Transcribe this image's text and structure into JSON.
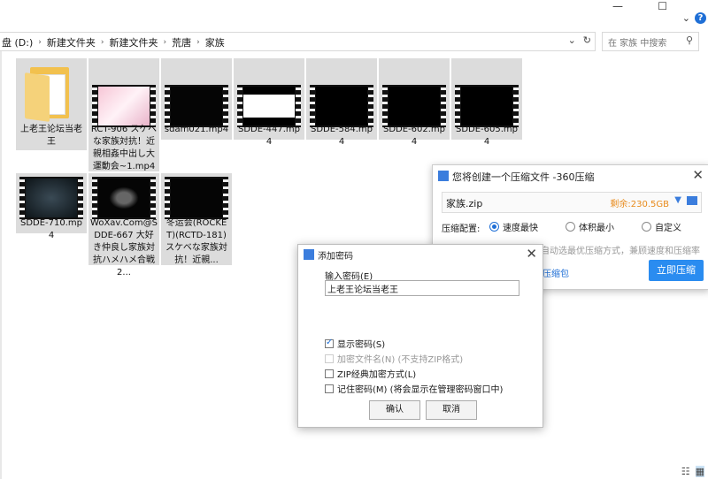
{
  "explorer": {
    "breadcrumbs": [
      "盘 (D:)",
      "新建文件夹",
      "新建文件夹",
      "荒唐",
      "家族"
    ],
    "search_placeholder": "在 家族 中搜索",
    "files": [
      {
        "name": "上老王论坛当老王",
        "type": "folder"
      },
      {
        "name": "RCT-906 スケベな家族対抗！近親相姦中出し大運動会~1.mp4",
        "type": "video"
      },
      {
        "name": "sdam021.mp4",
        "type": "video"
      },
      {
        "name": "SDDE-447.mp4",
        "type": "video"
      },
      {
        "name": "SDDE-584.mp4",
        "type": "video"
      },
      {
        "name": "SDDE-602.mp4",
        "type": "video"
      },
      {
        "name": "SDDE-605.mp4",
        "type": "video"
      },
      {
        "name": "SDDE-710.mp4",
        "type": "video"
      },
      {
        "name": "WoXav.Com@SDDE-667 大好き仲良し家族対抗ハメハメ合戦2...",
        "type": "video"
      },
      {
        "name": "冬运会(ROCKET)(RCTD-181)スケベな家族対抗！近親...",
        "type": "video"
      }
    ]
  },
  "compress_dialog": {
    "title": "您将创建一个压缩文件 -360压缩",
    "filename": "家族.zip",
    "free_space": "剩余:230.5GB",
    "config_label": "压缩配置:",
    "options": [
      "速度最快",
      "体积最小",
      "自定义"
    ],
    "hint": "自动选最优压缩方式，兼顾速度和压缩率",
    "link": "压缩包",
    "start_button": "立即压缩",
    "accent": "#2a8cf0"
  },
  "password_dialog": {
    "title": "添加密码",
    "label": "输入密码(E)",
    "password_value": "上老王论坛当老王",
    "checks": [
      {
        "label": "显示密码(S)",
        "checked": true,
        "disabled": false
      },
      {
        "label": "加密文件名(N) (不支持ZIP格式)",
        "checked": false,
        "disabled": true
      },
      {
        "label": "ZIP经典加密方式(L)",
        "checked": false,
        "disabled": false
      },
      {
        "label": "记住密码(M) (将会显示在管理密码窗口中)",
        "checked": false,
        "disabled": false
      }
    ],
    "ok_label": "确认",
    "cancel_label": "取消"
  }
}
